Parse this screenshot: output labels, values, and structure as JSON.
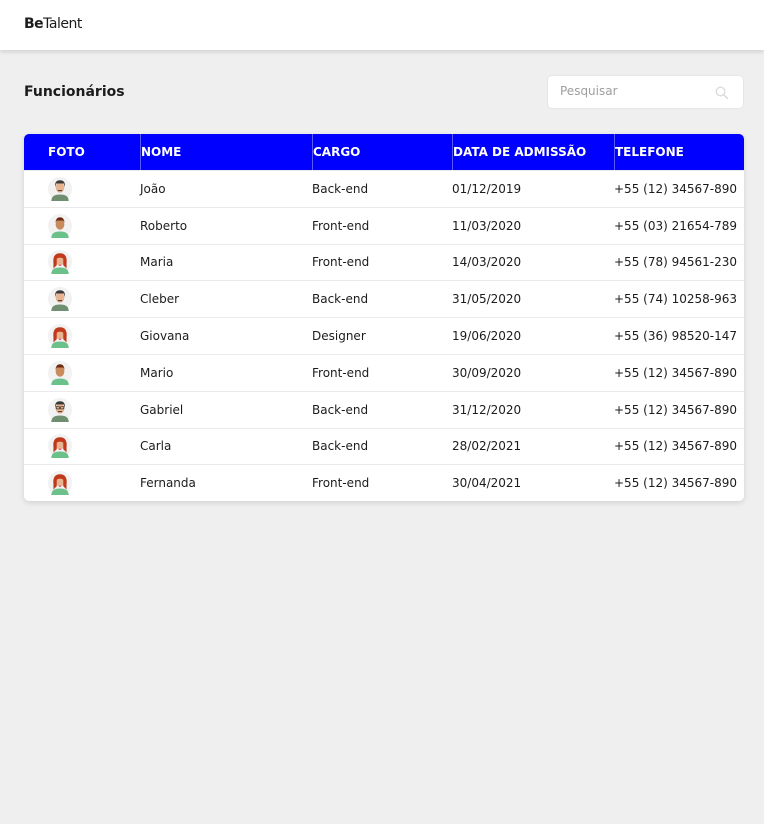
{
  "header": {
    "logo_bold": "Be",
    "logo_rest": "Talent"
  },
  "page": {
    "title": "Funcionários"
  },
  "search": {
    "placeholder": "Pesquisar",
    "value": "",
    "icon": "search-icon"
  },
  "colors": {
    "accent": "#0000ff",
    "background": "#efefef"
  },
  "table": {
    "columns": [
      "FOTO",
      "NOME",
      "CARGO",
      "DATA DE ADMISSÃO",
      "TELEFONE"
    ],
    "rows": [
      {
        "avatar": "man-mustache",
        "name": "João",
        "role": "Back-end",
        "date": "01/12/2019",
        "phone": "+55 (12) 34567-890"
      },
      {
        "avatar": "boy",
        "name": "Roberto",
        "role": "Front-end",
        "date": "11/03/2020",
        "phone": "+55 (03) 21654-789"
      },
      {
        "avatar": "woman",
        "name": "Maria",
        "role": "Front-end",
        "date": "14/03/2020",
        "phone": "+55 (78) 94561-230"
      },
      {
        "avatar": "man-mustache",
        "name": "Cleber",
        "role": "Back-end",
        "date": "31/05/2020",
        "phone": "+55 (74) 10258-963"
      },
      {
        "avatar": "woman",
        "name": "Giovana",
        "role": "Designer",
        "date": "19/06/2020",
        "phone": "+55 (36) 98520-147"
      },
      {
        "avatar": "boy",
        "name": "Mario",
        "role": "Front-end",
        "date": "30/09/2020",
        "phone": "+55 (12) 34567-890"
      },
      {
        "avatar": "man-glasses",
        "name": "Gabriel",
        "role": "Back-end",
        "date": "31/12/2020",
        "phone": "+55 (12) 34567-890"
      },
      {
        "avatar": "woman",
        "name": "Carla",
        "role": "Back-end",
        "date": "28/02/2021",
        "phone": "+55 (12) 34567-890"
      },
      {
        "avatar": "woman",
        "name": "Fernanda",
        "role": "Front-end",
        "date": "30/04/2021",
        "phone": "+55 (12) 34567-890"
      }
    ]
  }
}
